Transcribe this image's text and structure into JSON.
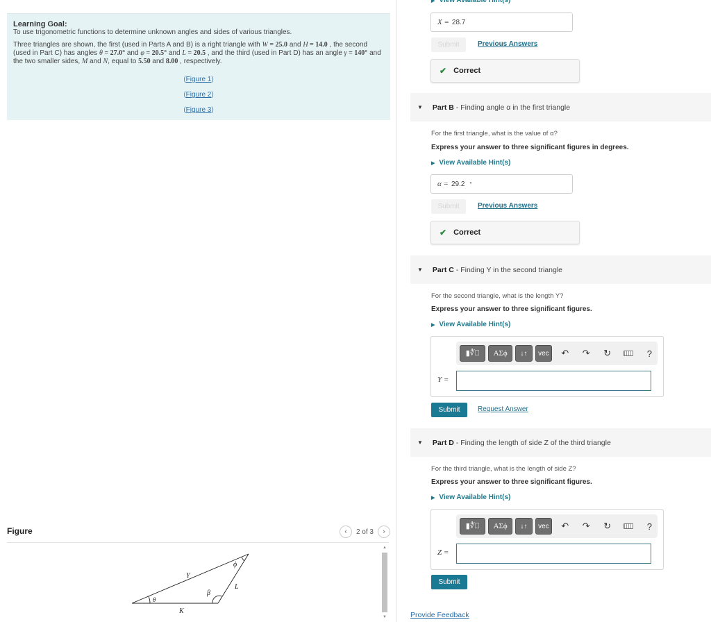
{
  "learning_goal": {
    "title": "Learning Goal:",
    "goal_text": "To use trigonometric functions to determine unknown angles and sides of various triangles.",
    "description": {
      "t1": "Three triangles are shown, the first (used in Parts A and B) is a right triangle with ",
      "W": "W",
      "eq1": " = 25.0",
      "t2": " and ",
      "H": "H",
      "eq2": " = 14.0",
      "t3": " , the second (used in Part C) has angles ",
      "theta": "θ",
      "eq3": " = 27.0°",
      "t4": " and ",
      "phi": "φ",
      "eq4": " = 20.5°",
      "t5": " and ",
      "L": "L",
      "eq5": " = 20.5",
      "t6": " , and the third (used in Part D) has an angle ",
      "gamma": "γ",
      "eq6": " = 140°",
      "t7": " and the two smaller sides, ",
      "M": "M",
      "t8": " and ",
      "N": "N",
      "t9": ", equal to ",
      "v1": "5.50",
      "t10": " and ",
      "v2": "8.00",
      "t11": " , respectively."
    },
    "figure_links": [
      "Figure 1",
      "Figure 2",
      "Figure 3"
    ]
  },
  "figure": {
    "title": "Figure",
    "pager": "2 of 3",
    "prev_icon": "‹",
    "next_icon": "›",
    "labels": {
      "Y": "Y",
      "phi": "ϕ",
      "L": "L",
      "beta": "β",
      "theta": "θ",
      "K": "K"
    }
  },
  "part_a": {
    "hint_label": "View Available Hint(s)",
    "answer_label": "X =",
    "answer_value": "28.7",
    "submit_label": "Submit",
    "previous_answers_label": "Previous Answers",
    "feedback": "Correct"
  },
  "part_b": {
    "name": "Part B",
    "description": "- Finding angle α in the first triangle",
    "question": "For the first triangle, what is the value of α?",
    "instruction": "Express your answer to three significant figures in degrees.",
    "hint_label": "View Available Hint(s)",
    "answer_label": "α =",
    "answer_value": "29.2",
    "answer_unit": "°",
    "submit_label": "Submit",
    "previous_answers_label": "Previous Answers",
    "feedback": "Correct"
  },
  "part_c": {
    "name": "Part C",
    "description": "- Finding Y in the second triangle",
    "question": "For the second triangle, what is the length Y?",
    "instruction": "Express your answer to three significant figures.",
    "hint_label": "View Available Hint(s)",
    "var_label": "Y =",
    "input_value": "",
    "submit_label": "Submit",
    "request_answer_label": "Request Answer"
  },
  "part_d": {
    "name": "Part D",
    "description": "- Finding the length of side Z of the third triangle",
    "question": "For the third triangle, what is the length of side Z?",
    "instruction": "Express your answer to three significant figures.",
    "hint_label": "View Available Hint(s)",
    "var_label": "Z =",
    "input_value": "",
    "submit_label": "Submit"
  },
  "toolbar": {
    "templates_label": "▮∜⎕",
    "greek_label": "ΑΣϕ",
    "arrows_label": "↓↑",
    "vec_label": "vec",
    "undo_icon": "↶",
    "redo_icon": "↷",
    "reset_icon": "↻",
    "help_label": "?"
  },
  "feedback_link": "Provide Feedback",
  "colors": {
    "accent": "#1a7a93",
    "link": "#2a6ea8",
    "correct": "#2e8b3e",
    "goal_bg": "#e6f3f5"
  }
}
